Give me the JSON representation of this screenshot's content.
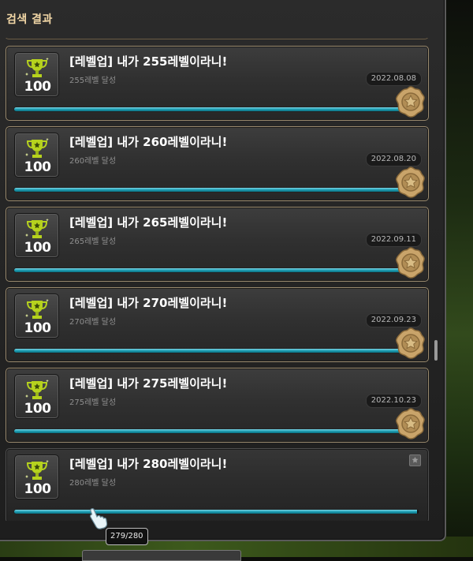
{
  "window": {
    "title": "검색 결과"
  },
  "achievements": [
    {
      "title": "[레벨업] 내가 255레벨이라니!",
      "subtitle": "255레벨 달성",
      "score": "100",
      "date": "2022.08.08",
      "progress": 1.0,
      "completed": true
    },
    {
      "title": "[레벨업] 내가 260레벨이라니!",
      "subtitle": "260레벨 달성",
      "score": "100",
      "date": "2022.08.20",
      "progress": 1.0,
      "completed": true
    },
    {
      "title": "[레벨업] 내가 265레벨이라니!",
      "subtitle": "265레벨 달성",
      "score": "100",
      "date": "2022.09.11",
      "progress": 1.0,
      "completed": true
    },
    {
      "title": "[레벨업] 내가 270레벨이라니!",
      "subtitle": "270레벨 달성",
      "score": "100",
      "date": "2022.09.23",
      "progress": 1.0,
      "completed": true
    },
    {
      "title": "[레벨업] 내가 275레벨이라니!",
      "subtitle": "275레벨 달성",
      "score": "100",
      "date": "2022.10.23",
      "progress": 1.0,
      "completed": true
    },
    {
      "title": "[레벨업] 내가 280레벨이라니!",
      "subtitle": "280레벨 달성",
      "score": "100",
      "date": "",
      "progress": 0.996,
      "completed": false
    }
  ],
  "tooltip": {
    "text": "279/280"
  },
  "colors": {
    "title": "#f2d7a6",
    "progress": "#1d9fb4",
    "trophy": "#b6d21e",
    "seal": "#c9a46a"
  },
  "icons": {
    "trophy": "trophy-icon",
    "seal": "completion-seal-icon",
    "lock": "locked-badge-icon",
    "cursor": "hand-cursor-icon"
  }
}
